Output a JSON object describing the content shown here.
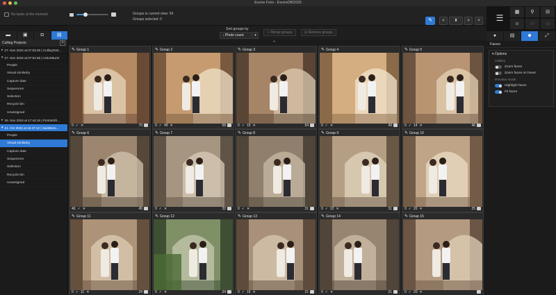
{
  "window": {
    "title": "Excire Foto - ExcireDB2025"
  },
  "toolbar": {
    "tasks_text": "No tasks at the moment",
    "zoom_fraction": 0.28,
    "groups_in_view": "Groups in current view: 56",
    "groups_selected": "Groups selected: 0",
    "nav_prev": "<",
    "nav_next": ">",
    "close": "×"
  },
  "sort": {
    "label": "Sort groups by",
    "selected": "Photo count",
    "merge_label": "Merge groups",
    "remove_label": "Remove groups"
  },
  "left_panel": {
    "title": "Culling Projects",
    "projects": [
      {
        "label": "27. Nov 2024 at 07:53:26 | CullingTest...",
        "expanded": false,
        "selected": false,
        "subs": []
      },
      {
        "label": "27. Nov 2024 at 07:51:56 | ActionBurst",
        "expanded": true,
        "selected": false,
        "subs": [
          "People",
          "Visual similarity",
          "Capture date",
          "Sequences",
          "Selection",
          "Recycle bin",
          "Unassigned"
        ]
      },
      {
        "label": "26. Nov 2024 at 17:44:16 | PortraitSh...",
        "expanded": false,
        "selected": false,
        "subs": []
      },
      {
        "label": "21. Oct 2024 at 16:47:12 | SaintBoni...",
        "expanded": true,
        "selected": true,
        "subs": [
          "People",
          "Visual similarity",
          "Capture date",
          "Sequences",
          "Selection",
          "Recycle bin",
          "Unassigned"
        ],
        "selected_sub": 1
      }
    ]
  },
  "groups": [
    {
      "name": "Group 1",
      "picked": "0",
      "rejected": "",
      "count": "70"
    },
    {
      "name": "Group 2",
      "picked": "0",
      "rejected": "49",
      "count": "58"
    },
    {
      "name": "Group 3",
      "picked": "0",
      "rejected": "15",
      "count": "54"
    },
    {
      "name": "Group 4",
      "picked": "0",
      "rejected": "",
      "count": "49"
    },
    {
      "name": "Group 5",
      "picked": "0",
      "rejected": "14",
      "count": "46"
    },
    {
      "name": "Group 6",
      "picked": "46",
      "rejected": "",
      "count": "45"
    },
    {
      "name": "Group 7",
      "picked": "0",
      "rejected": "",
      "count": "32"
    },
    {
      "name": "Group 8",
      "picked": "0",
      "rejected": "",
      "count": "31"
    },
    {
      "name": "Group 9",
      "picked": "0",
      "rejected": "22",
      "count": "31"
    },
    {
      "name": "Group 10",
      "picked": "0",
      "rejected": "20",
      "count": "25"
    },
    {
      "name": "Group 11",
      "picked": "0",
      "rejected": "11",
      "count": "24"
    },
    {
      "name": "Group 12",
      "picked": "0",
      "rejected": "",
      "count": "24"
    },
    {
      "name": "Group 13",
      "picked": "0",
      "rejected": "16",
      "count": "21"
    },
    {
      "name": "Group 14",
      "picked": "0",
      "rejected": "",
      "count": "21"
    },
    {
      "name": "Group 15",
      "picked": "0",
      "rejected": "20",
      "count": ""
    }
  ],
  "right_panel": {
    "title": "Faces",
    "options_label": "Options",
    "gallery_label": "Gallery",
    "preview_label": "Preview mode",
    "toggles": [
      {
        "label": "Zoom faces",
        "on": false,
        "section": "gallery"
      },
      {
        "label": "Zoom faces on hover",
        "on": false,
        "section": "gallery"
      },
      {
        "label": "Highlight faces",
        "on": true,
        "section": "preview"
      },
      {
        "label": "Fit faces",
        "on": true,
        "section": "preview"
      }
    ]
  },
  "colors": {
    "accent": "#2f7ad6",
    "bg": "#1b1b1b"
  }
}
